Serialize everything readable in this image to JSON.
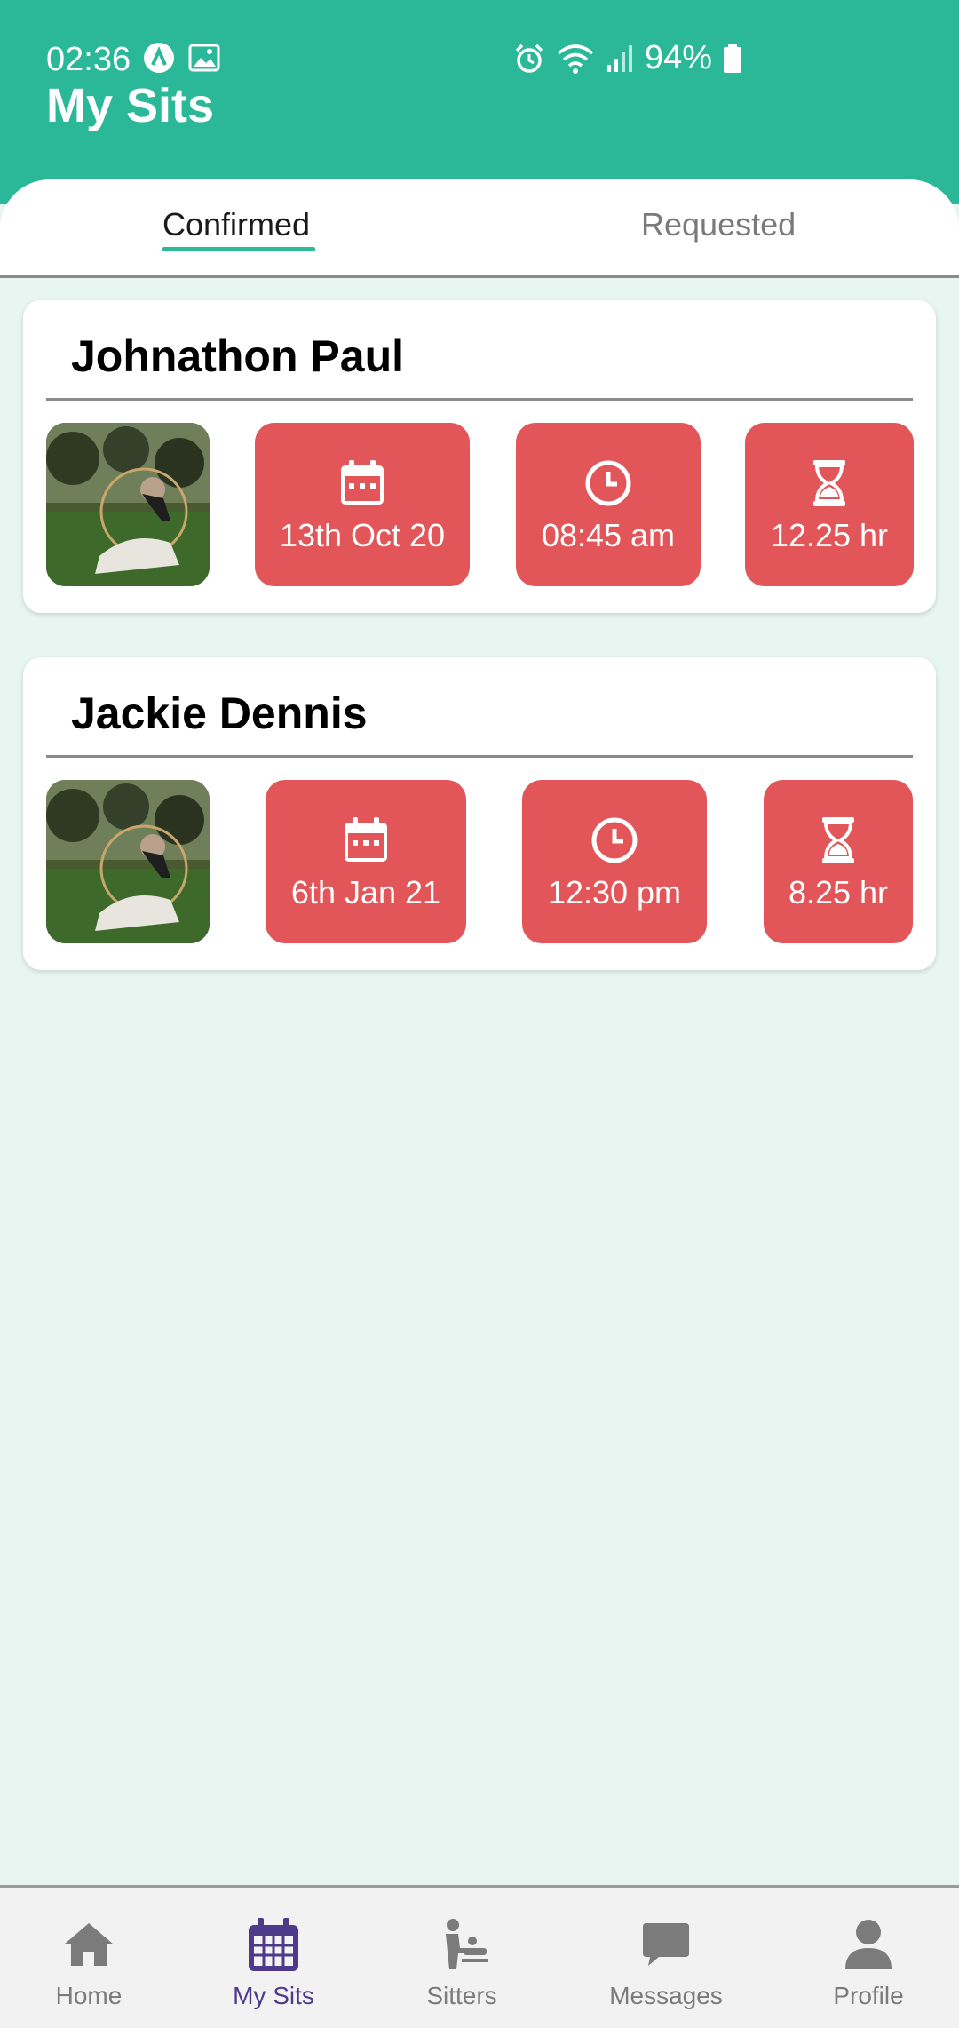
{
  "status_bar": {
    "time": "02:36",
    "battery": "94%"
  },
  "header": {
    "title": "My Sits"
  },
  "tabs": [
    {
      "label": "Confirmed",
      "active": true
    },
    {
      "label": "Requested",
      "active": false
    }
  ],
  "sits": [
    {
      "name": "Johnathon Paul",
      "date": "13th Oct 20",
      "time": "08:45 am",
      "duration": "12.25 hr"
    },
    {
      "name": "Jackie Dennis",
      "date": "6th Jan 21",
      "time": "12:30 pm",
      "duration": "8.25 hr"
    }
  ],
  "bottom_nav": [
    {
      "label": "Home",
      "icon": "home-icon"
    },
    {
      "label": "My Sits",
      "icon": "calendar-icon",
      "active": true
    },
    {
      "label": "Sitters",
      "icon": "sitter-icon"
    },
    {
      "label": "Messages",
      "icon": "chat-icon"
    },
    {
      "label": "Profile",
      "icon": "person-icon"
    }
  ],
  "colors": {
    "header": "#2bb899",
    "background": "#e8f6f2",
    "pill": "#e25558",
    "nav_active": "#4e3a8b",
    "nav_inactive": "#7b7b7b"
  }
}
